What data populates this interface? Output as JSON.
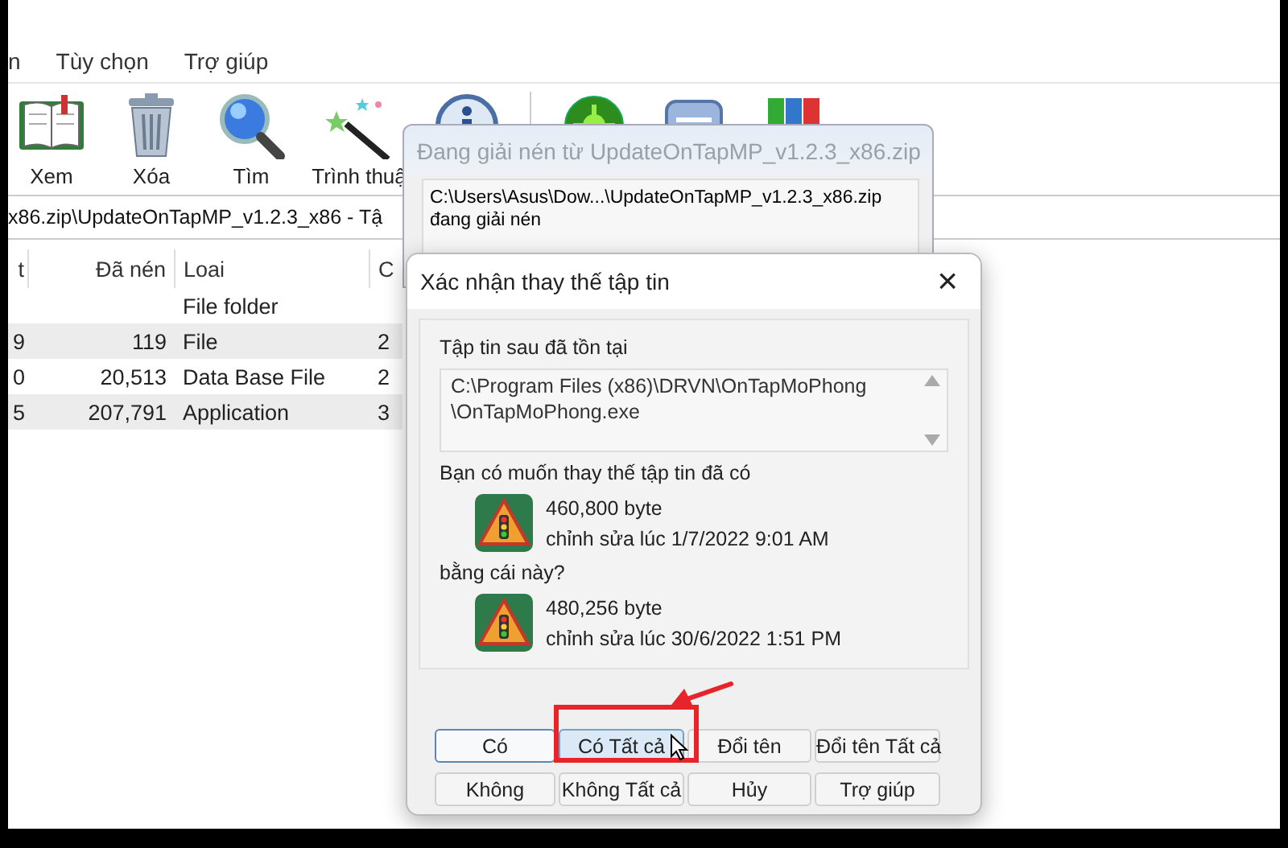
{
  "main_window": {
    "menu": [
      "n",
      "Tùy chọn",
      "Trợ giúp"
    ],
    "toolbar": [
      {
        "label": "Xem"
      },
      {
        "label": "Xóa"
      },
      {
        "label": "Tìm"
      },
      {
        "label": "Trình thuậ"
      }
    ],
    "address": "x86.zip\\UpdateOnTapMP_v1.2.3_x86 - Tậ",
    "table": {
      "columns": [
        "t",
        "Đã nén",
        "Loai",
        "C"
      ],
      "rows": [
        [
          "",
          "",
          "File folder",
          ""
        ],
        [
          "9",
          "119",
          "File",
          "2"
        ],
        [
          "0",
          "20,513",
          "Data Base File",
          "2"
        ],
        [
          "5",
          "207,791",
          "Application",
          "3"
        ]
      ]
    }
  },
  "progress_dialog": {
    "title": "Đang giải nén từ UpdateOnTapMP_v1.2.3_x86.zip",
    "lines": [
      "C:\\Users\\Asus\\Dow...\\UpdateOnTapMP_v1.2.3_x86.zip",
      "đang giải nén"
    ]
  },
  "confirm_dialog": {
    "title": "Xác nhận thay thế tập tin",
    "close": "×",
    "existing_label": "Tập tin sau đã tồn tại",
    "existing_path": [
      "C:\\Program Files (x86)\\DRVN\\OnTapMoPhong",
      "\\OnTapMoPhong.exe"
    ],
    "question": "Bạn có muốn thay thế tập tin đã có",
    "old_file": {
      "size": "460,800 byte",
      "modified": "chỉnh sửa lúc 1/7/2022 9:01 AM"
    },
    "with_label": "bằng cái này?",
    "new_file": {
      "size": "480,256 byte",
      "modified": "chỉnh sửa lúc 30/6/2022 1:51 PM"
    },
    "buttons": [
      {
        "label": "Có",
        "default": true,
        "hovered": false
      },
      {
        "label": "Có Tất cả",
        "default": false,
        "hovered": true
      },
      {
        "label": "Đổi tên",
        "default": false,
        "hovered": false
      },
      {
        "label": "Đổi tên Tất cả",
        "default": false,
        "hovered": false
      },
      {
        "label": "Không",
        "default": false,
        "hovered": false
      },
      {
        "label": "Không Tất cả",
        "default": false,
        "hovered": false
      },
      {
        "label": "Hủy",
        "default": false,
        "hovered": false
      },
      {
        "label": "Trợ giúp",
        "default": false,
        "hovered": false
      }
    ]
  }
}
